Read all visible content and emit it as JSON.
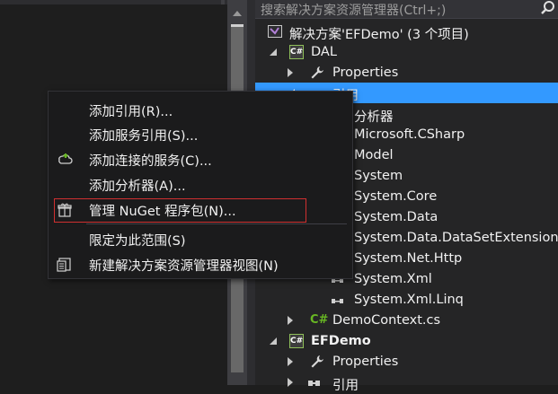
{
  "explorer": {
    "search_placeholder": "搜索解决方案资源管理器(Ctrl+;)",
    "solution_label": "解决方案'EFDemo' (3 个项目)",
    "rows": [
      {
        "label": "DAL"
      },
      {
        "label": "Properties"
      },
      {
        "label": "引用"
      },
      {
        "label": "分析器"
      },
      {
        "label": "Microsoft.CSharp"
      },
      {
        "label": "Model"
      },
      {
        "label": "System"
      },
      {
        "label": "System.Core"
      },
      {
        "label": "System.Data"
      },
      {
        "label": "System.Data.DataSetExtensions"
      },
      {
        "label": "System.Net.Http"
      },
      {
        "label": "System.Xml"
      },
      {
        "label": "System.Xml.Linq"
      },
      {
        "label": "DemoContext.cs"
      },
      {
        "label": "EFDemo"
      },
      {
        "label": "Properties"
      },
      {
        "label": "引用"
      }
    ]
  },
  "context_menu": {
    "items": [
      {
        "label": "添加引用(R)..."
      },
      {
        "label": "添加服务引用(S)..."
      },
      {
        "label": "添加连接的服务(C)..."
      },
      {
        "label": "添加分析器(A)..."
      },
      {
        "label": "管理 NuGet 程序包(N)..."
      },
      {
        "label": "限定为此范围(S)"
      },
      {
        "label": "新建解决方案资源管理器视图(N)"
      }
    ]
  },
  "colors": {
    "selection": "#3399ff",
    "highlight_border": "#d03030",
    "csharp_green": "#68b723"
  }
}
